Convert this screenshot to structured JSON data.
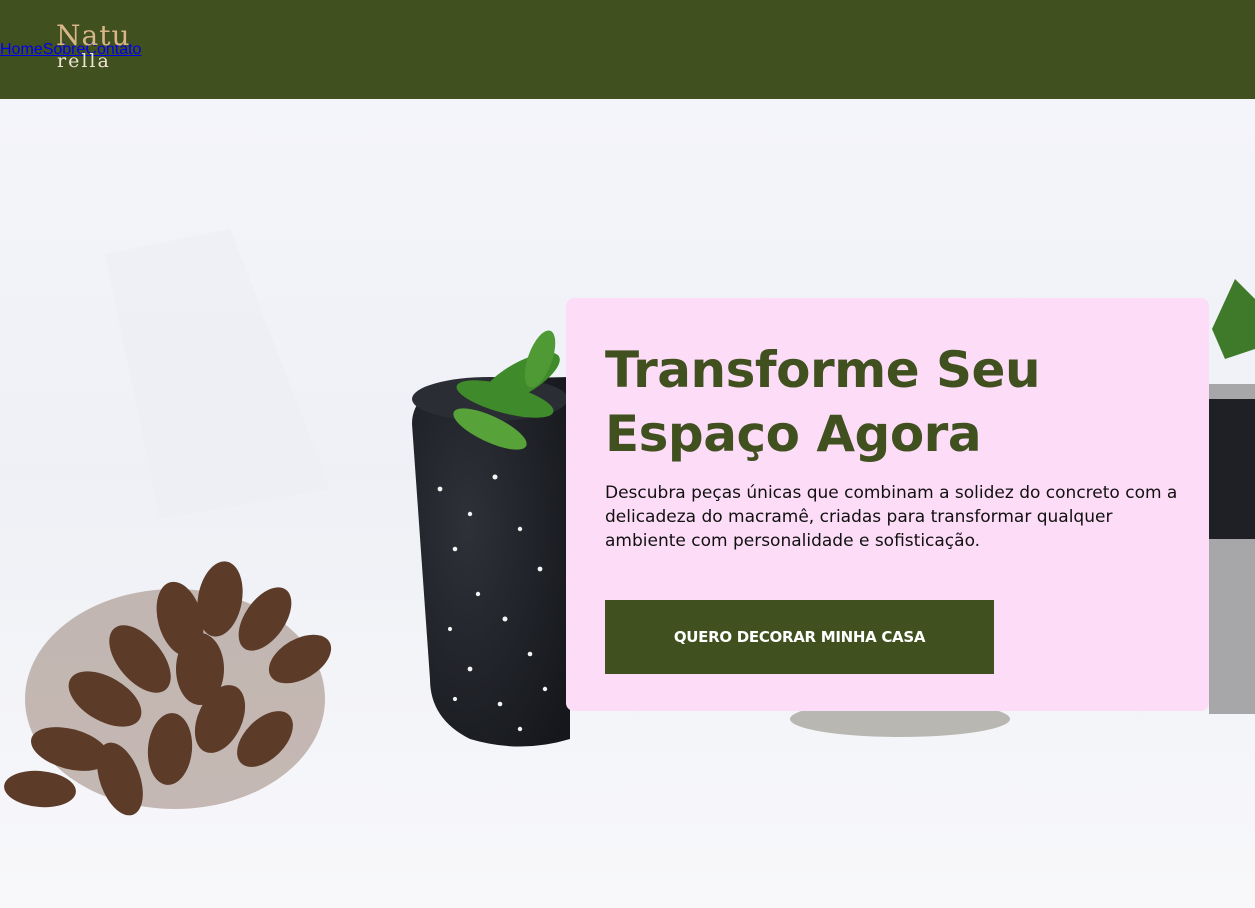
{
  "brand": {
    "logo_line1": "Natu",
    "logo_line2": "rella",
    "colors": {
      "primary": "#40501e",
      "card": "#fddcf8",
      "logo": "#d9b58a"
    }
  },
  "nav": {
    "items": [
      {
        "label": "Home"
      },
      {
        "label": "Sobre"
      },
      {
        "label": "Contato"
      }
    ]
  },
  "hero": {
    "title_line1": "Transforme Seu",
    "title_line2": "Espaço Agora",
    "description": "Descubra peças únicas que combinam a solidez do concreto com a delicadeza do macramê, criadas para transformar qualquer ambiente com personalidade e sofisticação.",
    "cta_label": "QUERO DECORAR MINHA CASA"
  }
}
